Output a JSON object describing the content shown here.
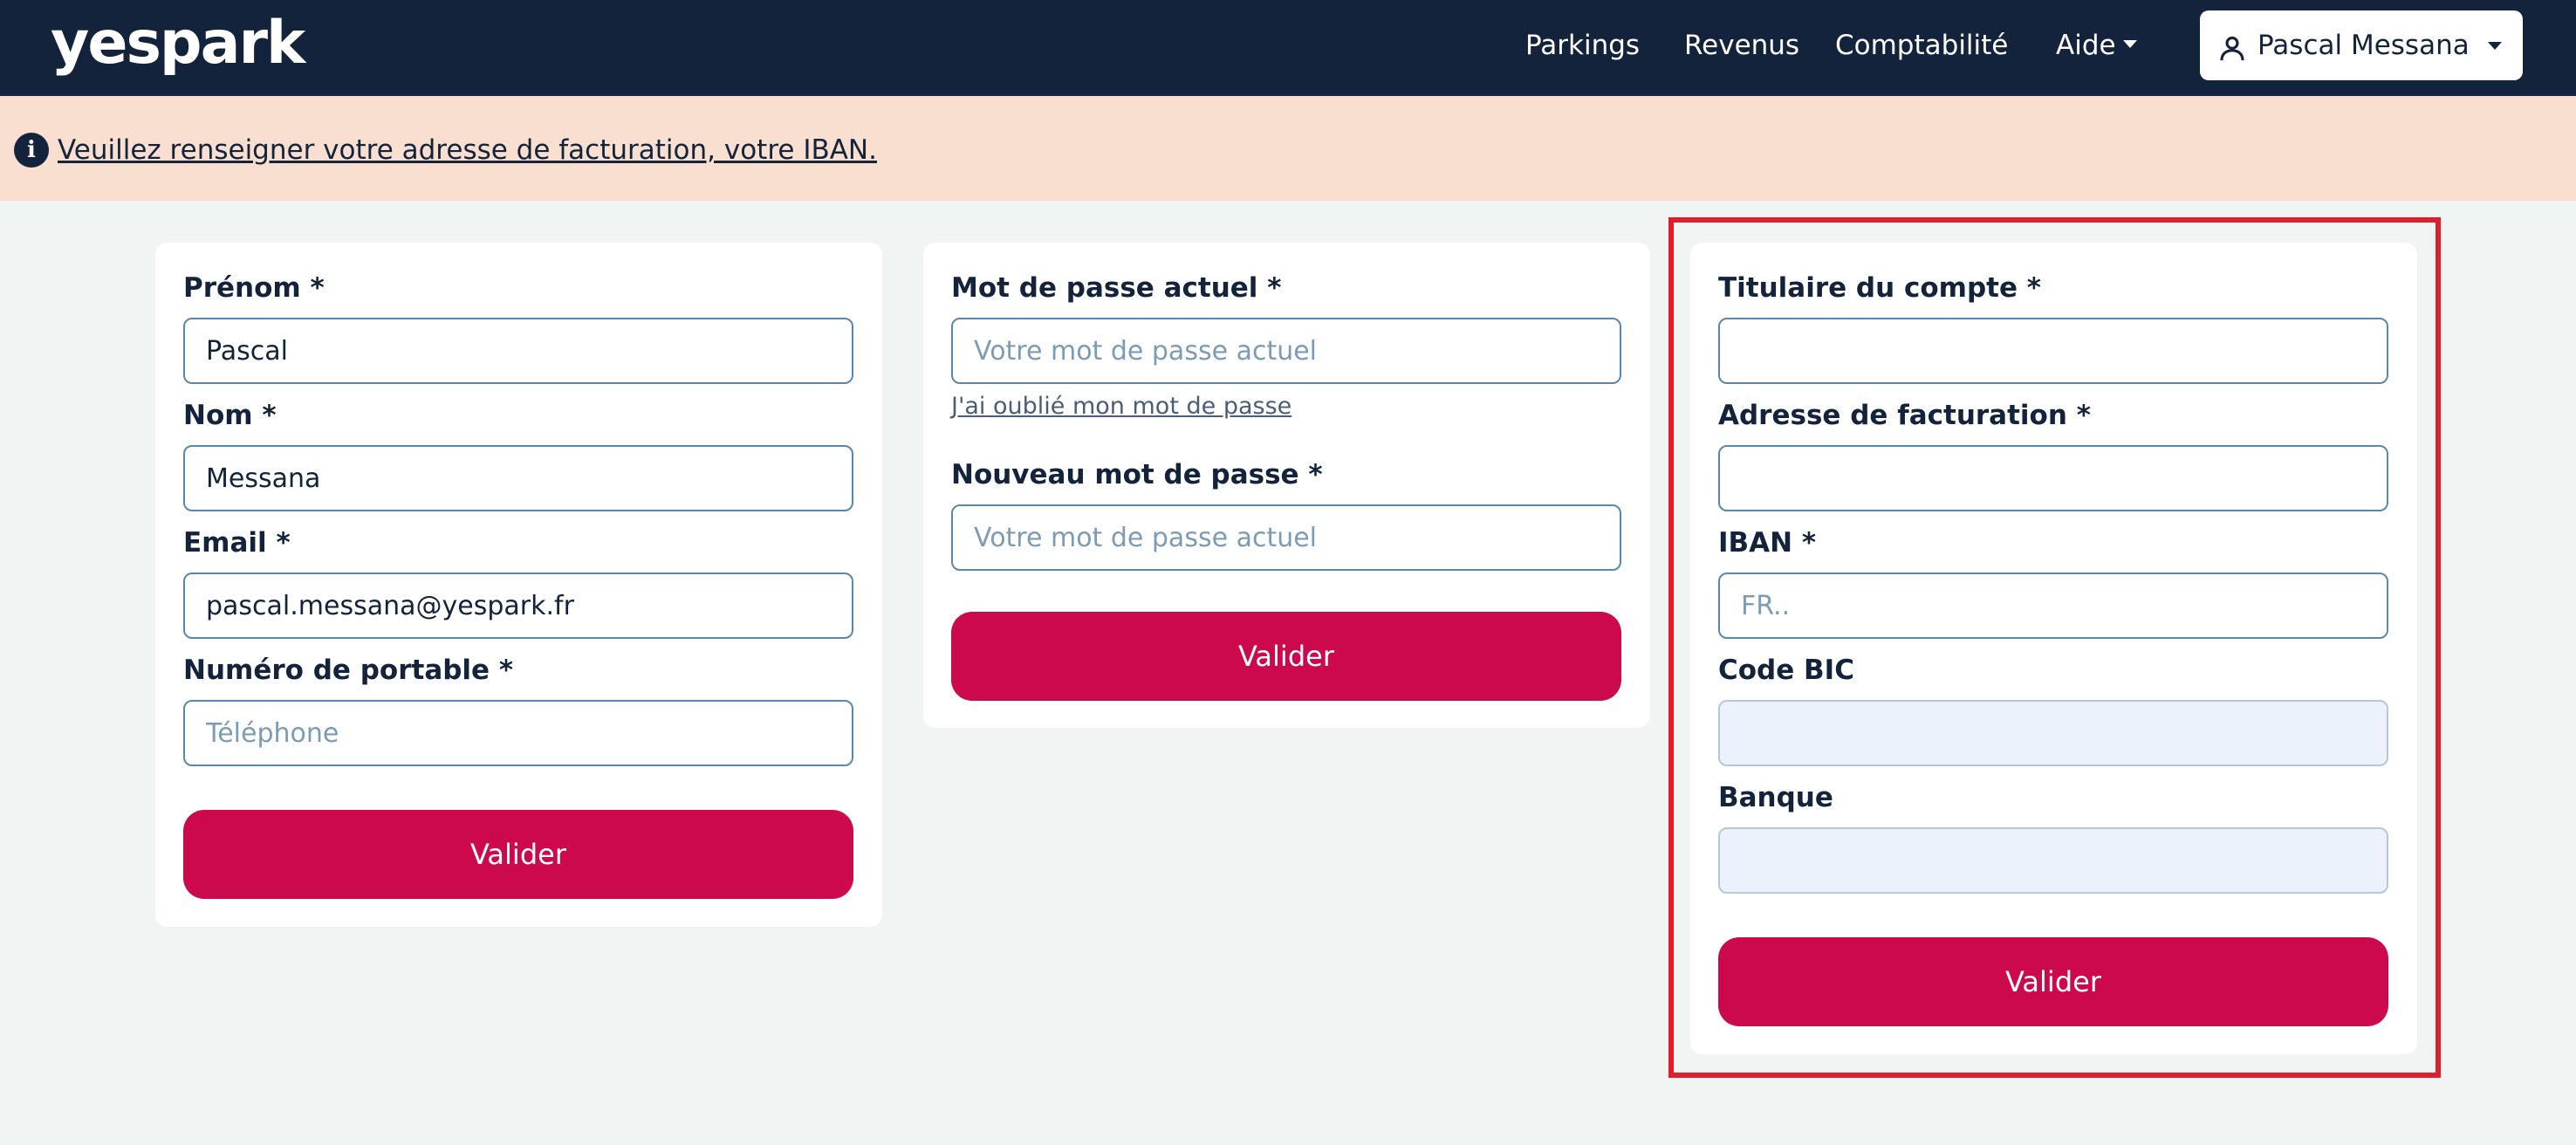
{
  "brand": {
    "logo_text": "yespark",
    "primary_color": "#cc094d",
    "nav_bg": "#13233b",
    "banner_bg": "#f9dfcf"
  },
  "nav": {
    "links": [
      "Parkings",
      "Revenus",
      "Comptabilité",
      "Aide"
    ],
    "user_name": "Pascal Messana"
  },
  "banner": {
    "icon": "info-icon",
    "text": " Veuillez renseigner votre adresse de facturation, votre IBAN."
  },
  "profile_form": {
    "first_name_label": "Prénom *",
    "first_name_value": "Pascal",
    "last_name_label": "Nom *",
    "last_name_value": "Messana",
    "email_label": "Email *",
    "email_value": "pascal.messana@yespark.fr",
    "phone_label": "Numéro de portable *",
    "phone_placeholder": "Téléphone",
    "submit_label": "Valider"
  },
  "password_form": {
    "current_label": "Mot de passe actuel *",
    "current_placeholder": "Votre mot de passe actuel",
    "forgot_link": "J'ai oublié mon mot de passe",
    "new_label": "Nouveau mot de passe *",
    "new_placeholder": "Votre mot de passe actuel",
    "submit_label": "Valider"
  },
  "bank_form": {
    "holder_label": "Titulaire du compte *",
    "address_label": "Adresse de facturation *",
    "iban_label": "IBAN *",
    "iban_placeholder": "FR..",
    "bic_label": "Code BIC",
    "bank_label": "Banque",
    "submit_label": "Valider"
  }
}
